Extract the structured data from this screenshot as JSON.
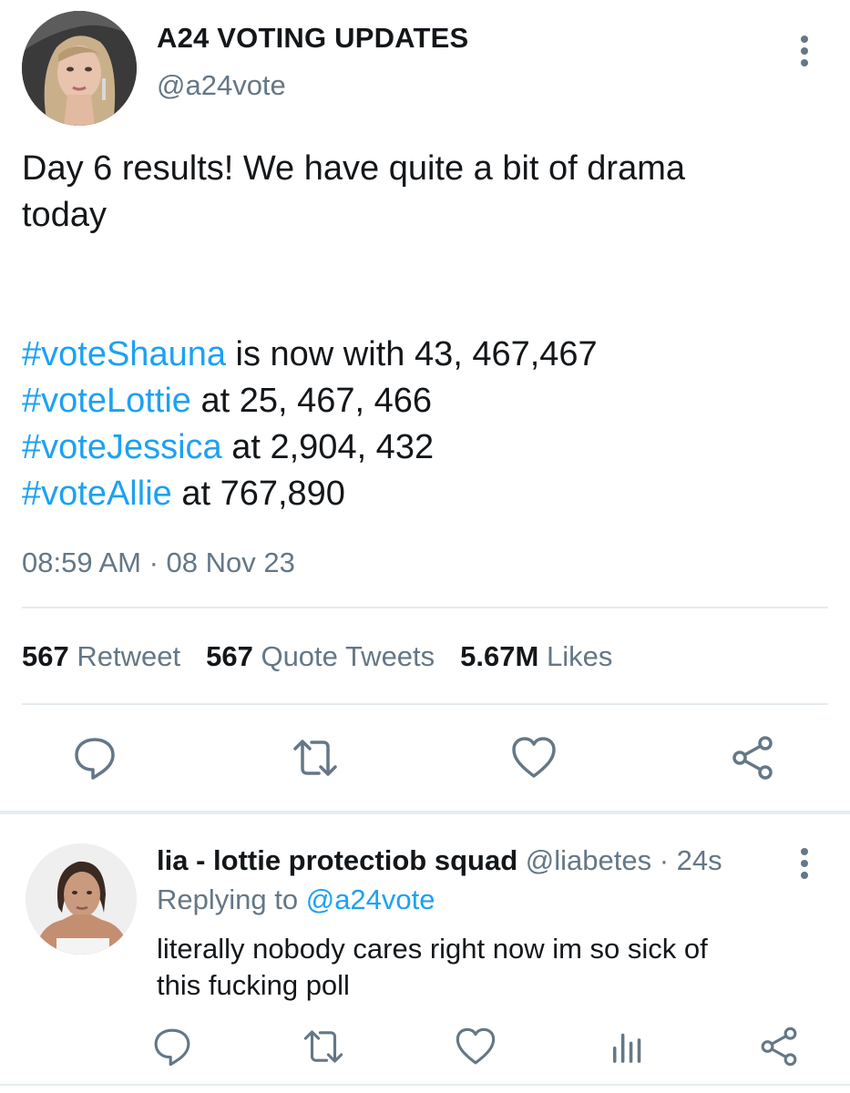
{
  "main_tweet": {
    "display_name": "A24 VOTING UPDATES",
    "handle": "@a24vote",
    "text_line_1": "Day 6 results! We have quite a bit of drama",
    "text_line_2": "today",
    "results": [
      {
        "hashtag": "#voteShauna",
        "text": " is now with 43, 467,467"
      },
      {
        "hashtag": "#voteLottie",
        "text": " at 25, 467, 466"
      },
      {
        "hashtag": "#voteJessica",
        "text": " at 2,904, 432"
      },
      {
        "hashtag": "#voteAllie",
        "text": " at 767,890"
      }
    ],
    "timestamp": "08:59 AM · 08 Nov 23",
    "stats": {
      "retweets_count": "567",
      "retweets_label": "Retweet",
      "quotes_count": "567",
      "quotes_label": "Quote Tweets",
      "likes_count": "5.67M",
      "likes_label": "Likes"
    },
    "actions": [
      "reply-icon",
      "retweet-icon",
      "like-icon",
      "share-icon"
    ]
  },
  "reply": {
    "display_name": "lia - lottie protectiob squad",
    "handle": "@liabetes",
    "separator": "·",
    "time": "24s",
    "replying_label": "Replying to",
    "replying_to": "@a24vote",
    "text_line_1": "literally nobody cares right now im so sick of",
    "text_line_2": "this fucking poll",
    "actions": [
      "reply-icon",
      "retweet-icon",
      "like-icon",
      "analytics-icon",
      "share-icon"
    ]
  },
  "colors": {
    "link": "#1da1f2",
    "secondary_text": "#657786",
    "primary_text": "#14171a",
    "icon": "#657786",
    "divider": "#e6ecf0"
  }
}
